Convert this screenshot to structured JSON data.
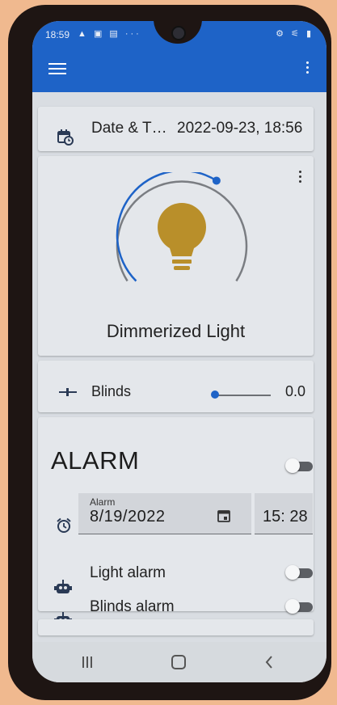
{
  "status_bar": {
    "time": "18:59",
    "left_icons": "▲ ▣ ▤ ···",
    "right_icons": "⚙ ⚟ ▮"
  },
  "app_bar": {
    "menu_icon": "hamburger-icon",
    "more_icon": "more-vert-icon"
  },
  "datetime": {
    "label": "Date & T…",
    "value": "2022-09-23, 18:56",
    "icon": "calendar-clock-icon"
  },
  "light": {
    "name": "Dimmerized Light",
    "level_fraction": 0.62,
    "bulb_color": "#b98f2a",
    "arc_color": "#1e63c7"
  },
  "blinds": {
    "label": "Blinds",
    "value": "0.0",
    "slider_fraction": 0.0
  },
  "alarm": {
    "title": "ALARM",
    "enabled": false,
    "date_label": "Alarm",
    "date_value": "8/19/2022",
    "time_value": "15: 28",
    "light_alarm_label": "Light alarm",
    "light_alarm_enabled": false,
    "blinds_alarm_label": "Blinds alarm",
    "blinds_alarm_enabled": false
  },
  "nav_bar": {
    "recent_icon": "recent-apps-icon",
    "home_icon": "home-icon",
    "back_icon": "back-icon"
  },
  "colors": {
    "primary": "#1e63c7",
    "bulb": "#b98f2a",
    "card": "#e4e7eb"
  }
}
